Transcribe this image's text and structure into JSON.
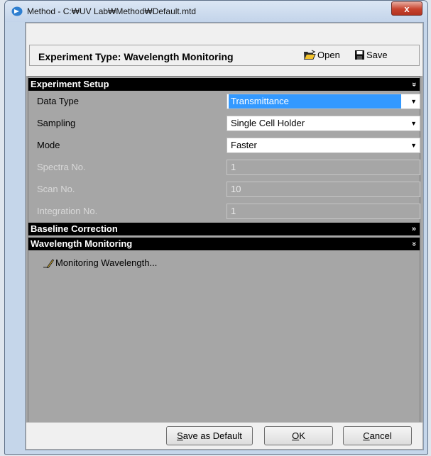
{
  "window": {
    "title": "Method - C:₩UV Lab₩Method₩Default.mtd",
    "close_label": "x"
  },
  "header": {
    "experiment_type": "Experiment Type:  Wavelength Monitoring",
    "open_label": "Open",
    "save_label": "Save"
  },
  "sections": {
    "experiment_setup": {
      "title": "Experiment Setup",
      "chevron": "»"
    },
    "baseline_correction": {
      "title": "Baseline Correction",
      "chevron": "»"
    },
    "wavelength_monitoring": {
      "title": "Wavelength Monitoring",
      "chevron": "»"
    }
  },
  "setup": {
    "data_type": {
      "label": "Data Type",
      "value": "Transmittance"
    },
    "sampling": {
      "label": "Sampling",
      "value": "Single Cell Holder"
    },
    "mode": {
      "label": "Mode",
      "value": "Faster"
    },
    "spectra_no": {
      "label": "Spectra No.",
      "value": "1"
    },
    "scan_no": {
      "label": "Scan No.",
      "value": "10"
    },
    "integration_no": {
      "label": "Integration No.",
      "value": "1"
    }
  },
  "monitoring": {
    "link_label": "Monitoring Wavelength..."
  },
  "footer": {
    "save_default_prefix": "S",
    "save_default_rest": "ave as Default",
    "ok_prefix": "O",
    "ok_rest": "K",
    "cancel_prefix": "C",
    "cancel_rest": "ancel"
  },
  "icons": {
    "app": "app-icon",
    "open": "open-folder-icon",
    "save": "floppy-disk-icon",
    "pencil": "pencil-icon",
    "dropdown": "chevron-down-icon"
  },
  "colors": {
    "selection": "#3399ff",
    "section_header": "#000000",
    "panel_background": "#a6a6a6",
    "close_button": "#c7432d"
  }
}
